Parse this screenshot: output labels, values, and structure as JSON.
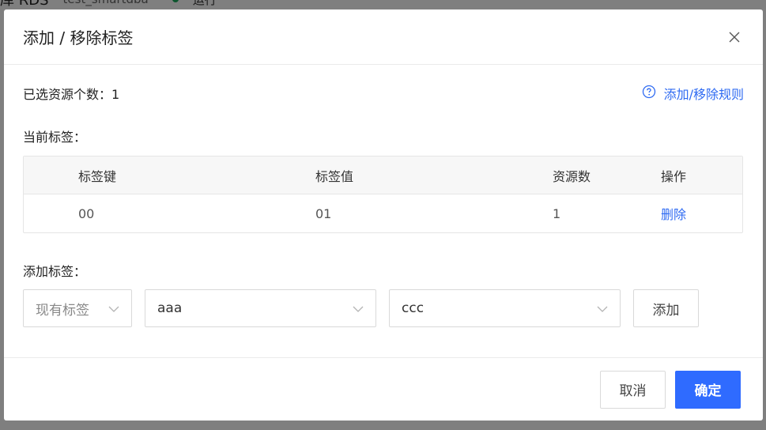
{
  "background": {
    "title": "库 RDS",
    "instance_name": "test_smartdba",
    "status": "运行",
    "status_color": "#1aab5c"
  },
  "modal": {
    "title": "添加 / 移除标签",
    "close_icon": "close-icon",
    "selected_label": "已选资源个数：1",
    "rules_link": "添加/移除规则",
    "rules_icon": "question-circle-icon",
    "current_tags_label": "当前标签：",
    "table": {
      "headers": [
        "标签键",
        "标签值",
        "资源数",
        "操作"
      ],
      "rows": [
        {
          "key": "00",
          "value": "01",
          "count": "1",
          "action": "删除"
        }
      ]
    },
    "add_tags_label": "添加标签：",
    "add": {
      "type_select": "现有标签",
      "key_select": "aaa",
      "value_select": "ccc",
      "add_button": "添加"
    },
    "footer": {
      "cancel": "取消",
      "confirm": "确定"
    },
    "accent_color": "#2f6bff"
  }
}
